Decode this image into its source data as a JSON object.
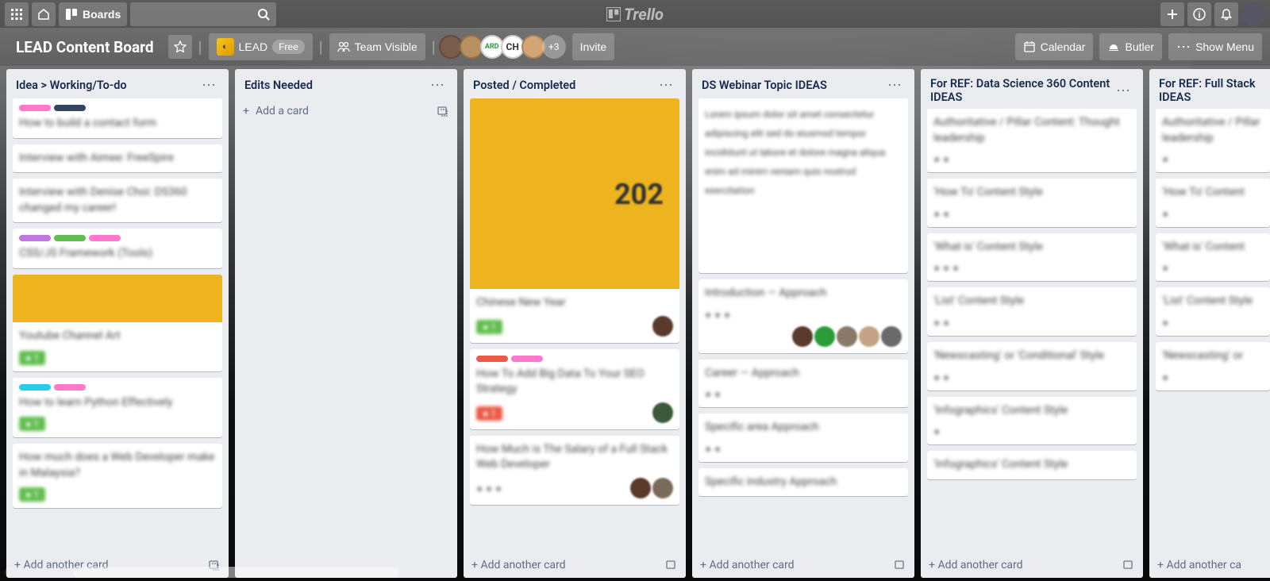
{
  "topbar": {
    "boards_label": "Boards",
    "logo_text": "Trello"
  },
  "boardbar": {
    "title": "LEAD Content Board",
    "workspace": "LEAD",
    "plan_badge": "Free",
    "visibility": "Team Visible",
    "extra_members": "+3",
    "invite": "Invite",
    "calendar": "Calendar",
    "butler": "Butler",
    "show_menu": "Show Menu",
    "member_initials": [
      "",
      "",
      "",
      "CH",
      ""
    ]
  },
  "lists": [
    {
      "title": "Idea > Working/To-do",
      "footer": "Add another card",
      "cards": [
        {
          "labels": [
            "pink",
            "black"
          ],
          "text": "How to build a contact form",
          "badges": []
        },
        {
          "labels": [],
          "text": "Interview with Aimee: FreeSpire",
          "badges": []
        },
        {
          "labels": [],
          "text": "Interview with Denise Choi: DS360 changed my career!",
          "badges": []
        },
        {
          "labels": [
            "purple",
            "green",
            "pink"
          ],
          "text": "CSS/JS Framework (Tools)",
          "badges": []
        },
        {
          "labels": [],
          "text": "Youtube Channel Art",
          "badges": [
            "chip"
          ],
          "cover": true
        },
        {
          "labels": [
            "cyan",
            "pink"
          ],
          "text": "How to learn Python Effectively",
          "badges": [
            "chip"
          ]
        },
        {
          "labels": [],
          "text": "How much does a Web Developer make in Malaysia?",
          "badges": [
            "chip"
          ]
        }
      ]
    },
    {
      "title": "Edits Needed",
      "add_card": "Add a card",
      "cards": []
    },
    {
      "title": "Posted / Completed",
      "footer": "Add another card",
      "cards": [
        {
          "labels": [],
          "text": "Chinese New Year",
          "badges": [
            "chip"
          ],
          "cover": "tall",
          "members": 1
        },
        {
          "labels": [
            "red",
            "pink"
          ],
          "text": "How To Add Big Data To Your SEO Strategy",
          "badges": [
            "chip"
          ],
          "members": 1
        },
        {
          "labels": [],
          "text": "How Much is The Salary of a Full Stack Web Developer",
          "badges": [],
          "members": 2
        }
      ]
    },
    {
      "title": "DS Webinar Topic IDEAS",
      "footer": "Add another card",
      "cards": [
        {
          "labels": [],
          "text": "Lorem ipsum dolor sit amet consectetur adipiscing elit sed do eiusmod tempor incididunt ut labore et dolore magna aliqua enim ad minim veniam quis nostrud exercitation",
          "badges": [],
          "tall_text": true
        },
        {
          "labels": [],
          "text": "Introduction — Approach",
          "badges": [],
          "members": 5
        },
        {
          "labels": [],
          "text": "Career — Approach",
          "badges": []
        },
        {
          "labels": [],
          "text": "Specific area Approach",
          "badges": []
        },
        {
          "labels": [],
          "text": "Specific industry Approach",
          "badges": []
        }
      ]
    },
    {
      "title": "For REF: Data Science 360 Content IDEAS",
      "footer": "Add another card",
      "cards": [
        {
          "labels": [],
          "text": "Authoritative / Pillar Content: Thought leadership",
          "badges": []
        },
        {
          "labels": [],
          "text": "'How To' Content Style",
          "badges": []
        },
        {
          "labels": [],
          "text": "'What is' Content Style",
          "badges": []
        },
        {
          "labels": [],
          "text": "'List' Content Style",
          "badges": []
        },
        {
          "labels": [],
          "text": "'Newscasting' or 'Conditional' Style",
          "badges": []
        },
        {
          "labels": [],
          "text": "'Infographics' Content Style",
          "badges": []
        },
        {
          "labels": [],
          "text": "'Infographics' Content Style",
          "badges": []
        }
      ]
    },
    {
      "title": "For REF: Full Stack IDEAS",
      "footer": "Add another ca",
      "cards": [
        {
          "labels": [],
          "text": "Authoritative / Pillar leadership",
          "badges": []
        },
        {
          "labels": [],
          "text": "'How To' Content",
          "badges": []
        },
        {
          "labels": [],
          "text": "'What is' Content",
          "badges": []
        },
        {
          "labels": [],
          "text": "'List' Content Style",
          "badges": []
        },
        {
          "labels": [],
          "text": "'Newscasting' or",
          "badges": []
        }
      ]
    }
  ]
}
